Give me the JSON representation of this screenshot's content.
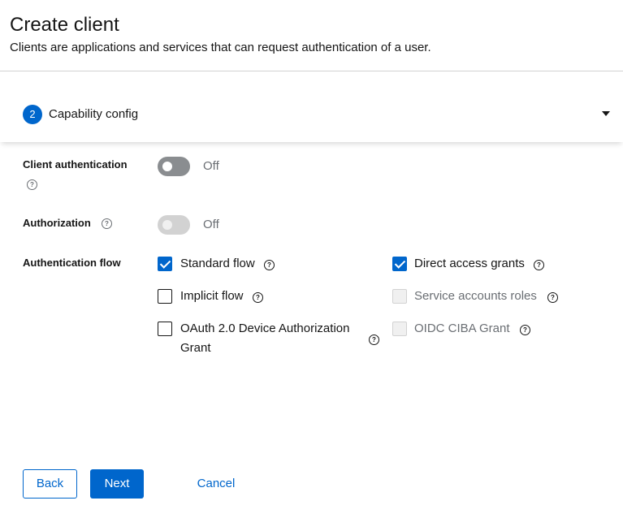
{
  "header": {
    "title": "Create client",
    "description": "Clients are applications and services that can request authentication of a user."
  },
  "step": {
    "number": "2",
    "label": "Capability config",
    "expand_icon": "caret-down-icon"
  },
  "fields": {
    "client_authentication": {
      "label": "Client authentication",
      "state_text": "Off",
      "on": false,
      "disabled": false
    },
    "authorization": {
      "label": "Authorization",
      "state_text": "Off",
      "on": false,
      "disabled": true
    },
    "authentication_flow": {
      "label": "Authentication flow",
      "options": {
        "standard_flow": {
          "label": "Standard flow",
          "checked": true,
          "disabled": false
        },
        "direct_access_grants": {
          "label": "Direct access grants",
          "checked": true,
          "disabled": false
        },
        "implicit_flow": {
          "label": "Implicit flow",
          "checked": false,
          "disabled": false
        },
        "service_accounts_roles": {
          "label": "Service accounts roles",
          "checked": false,
          "disabled": true
        },
        "oauth_device_line1": "OAuth 2.0 Device Authorization",
        "oauth_device_line2": "Grant",
        "oidc_ciba_grant": {
          "label": "OIDC CIBA Grant",
          "checked": false,
          "disabled": true
        }
      }
    }
  },
  "help_icon_glyph": "?",
  "buttons": {
    "back": "Back",
    "next": "Next",
    "cancel": "Cancel"
  },
  "colors": {
    "primary": "#0066cc",
    "text": "#151515",
    "muted": "#6a6e73",
    "border": "#d2d2d2"
  }
}
